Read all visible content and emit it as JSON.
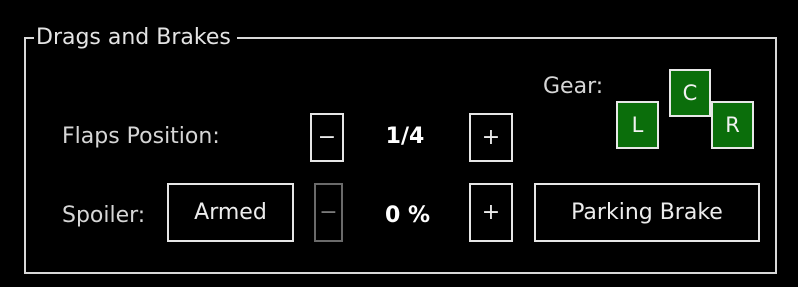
{
  "panel": {
    "title": "Drags and Brakes",
    "gear": {
      "label": "Gear:",
      "left": "L",
      "center": "C",
      "right": "R",
      "indicator_color": "#0b6e0b"
    },
    "flaps": {
      "label": "Flaps Position:",
      "decrement": "−",
      "value": "1/4",
      "increment": "+"
    },
    "spoiler": {
      "label": "Spoiler:",
      "mode_button": "Armed",
      "decrement": "−",
      "value": "0 %",
      "increment": "+"
    },
    "parking_brake": "Parking Brake"
  }
}
